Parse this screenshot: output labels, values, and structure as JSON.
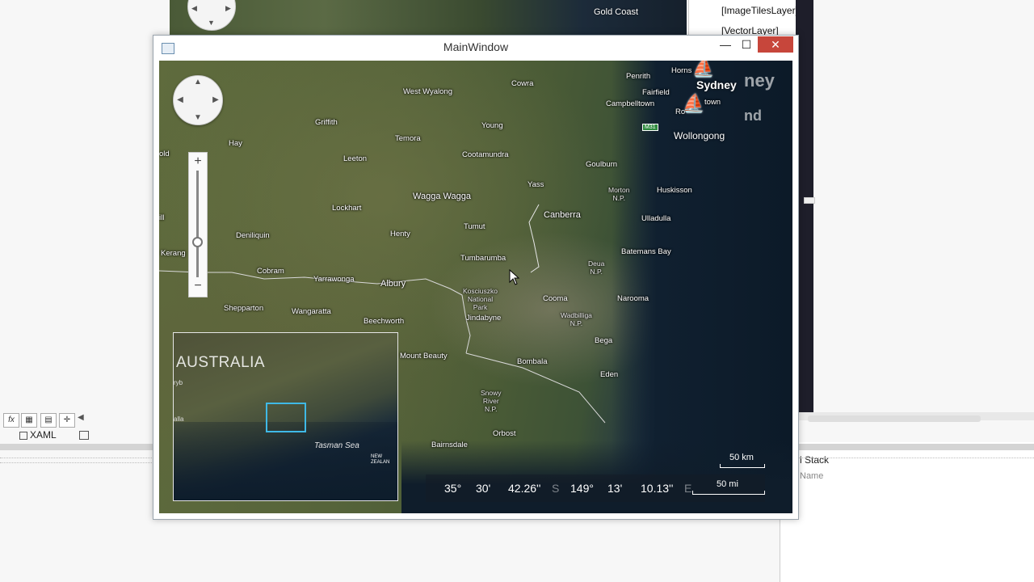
{
  "background": {
    "map_city": "Gold Coast",
    "layers": [
      "[ImageTilesLayer]",
      "[VectorLayer]"
    ],
    "xaml_tab": "XAML",
    "call_stack": "l Stack",
    "name_header": "Name",
    "toolbar_icons": [
      "fx-icon",
      "grid-icon",
      "grid-alt-icon",
      "select-icon",
      "arrow-left-icon"
    ]
  },
  "window": {
    "title": "MainWindow",
    "minimize": "—",
    "maximize": "☐",
    "close": "✕"
  },
  "map": {
    "cities": {
      "cowra": "Cowra",
      "penrith": "Penrith",
      "hornsby": "Horns",
      "fairfield": "Fairfield",
      "west_wyalong": "West Wyalong",
      "campbelltown": "Campbelltown",
      "griffith": "Griffith",
      "young": "Young",
      "hay": "Hay",
      "temora": "Temora",
      "cootamundra": "Cootamundra",
      "leeton": "Leeton",
      "goulburn": "Goulburn",
      "yass": "Yass",
      "wagga": "Wagga Wagga",
      "morton": "Morton",
      "morton_np": "N.P.",
      "huskisson": "Huskisson",
      "canberra": "Canberra",
      "lockhart": "Lockhart",
      "ulladulla": "Ulladulla",
      "deniliquin": "Deniliquin",
      "tumut": "Tumut",
      "henty": "Henty",
      "batemans": "Batemans Bay",
      "kerang": "Kerang",
      "tumbarumba": "Tumbarumba",
      "deua": "Deua",
      "deua_np": "N.P.",
      "cobram": "Cobram",
      "yarrawonga": "Yarrawonga",
      "albury": "Albury",
      "kosciuszko": "Kosciuszko",
      "national": "National",
      "park": "Park",
      "cooma": "Cooma",
      "narooma": "Narooma",
      "shepparton": "Shepparton",
      "wangaratta": "Wangaratta",
      "jindabyne": "Jindabyne",
      "wadbilliga": "Wadbilliga",
      "wadbilliga_np": "N.P.",
      "beechworth": "Beechworth",
      "bega": "Bega",
      "mount_beauty": "Mount Beauty",
      "bombala": "Bombala",
      "eden": "Eden",
      "snowy": "Snowy",
      "river": "River",
      "snowy_np": "N.P.",
      "orbost": "Orbost",
      "bairnsdale": "Bairnsdale",
      "ill": "ill",
      "olid": "old"
    },
    "sydney": "Sydney",
    "wollongong": "Wollongong",
    "town_suffix": "town",
    "ro": "Ro",
    "faded_ney": "ney",
    "faded_nd": "nd",
    "highway": "M31",
    "highway2": "M1",
    "overview": {
      "label": "AUSTRALIA",
      "tasman": "Tasman Sea",
      "new_zealand": "NEW\nZEALAN",
      "faded1": "ryb",
      "faded2": "alla"
    },
    "coordinates": {
      "lat_deg": "35°",
      "lat_min": "30'",
      "lat_sec": "42.26''",
      "lat_dir": "S",
      "lon_deg": "149°",
      "lon_min": "13'",
      "lon_sec": "10.13''",
      "lon_dir": "E"
    },
    "scale": {
      "km": "50 km",
      "mi": "50 mi"
    },
    "zoom": {
      "in": "+",
      "out": "−",
      "level": 0.36
    }
  }
}
